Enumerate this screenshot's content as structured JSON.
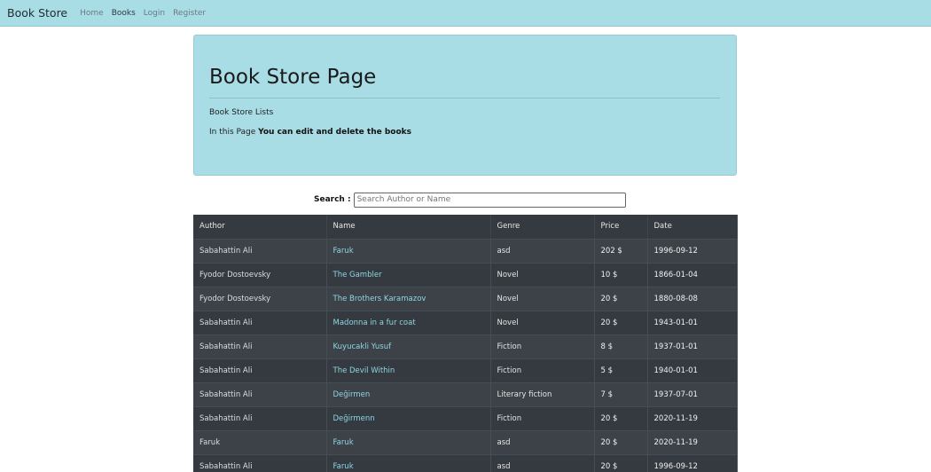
{
  "navbar": {
    "brand": "Book Store",
    "links": [
      {
        "label": "Home"
      },
      {
        "label": "Books"
      },
      {
        "label": "Login"
      },
      {
        "label": "Register"
      }
    ]
  },
  "jumbotron": {
    "title": "Book Store Page",
    "subtitle": "Book Store Lists",
    "description_prefix": "In this Page ",
    "description_bold": "You can edit and delete the books"
  },
  "search": {
    "label": "Search :",
    "placeholder": "Search Author or Name"
  },
  "table": {
    "headers": [
      "Author",
      "Name",
      "Genre",
      "Price",
      "Date"
    ],
    "rows": [
      {
        "author": "Sabahattin Ali",
        "name": "Faruk",
        "genre": "asd",
        "price": "202 $",
        "date": "1996-09-12"
      },
      {
        "author": "Fyodor Dostoevsky",
        "name": "The Gambler",
        "genre": "Novel",
        "price": "10 $",
        "date": "1866-01-04"
      },
      {
        "author": "Fyodor Dostoevsky",
        "name": "The Brothers Karamazov",
        "genre": "Novel",
        "price": "20 $",
        "date": "1880-08-08"
      },
      {
        "author": "Sabahattin Ali",
        "name": "Madonna in a fur coat",
        "genre": "Novel",
        "price": "20 $",
        "date": "1943-01-01"
      },
      {
        "author": "Sabahattin Ali",
        "name": "Kuyucakli Yusuf",
        "genre": "Fiction",
        "price": "8 $",
        "date": "1937-01-01"
      },
      {
        "author": "Sabahattin Ali",
        "name": "The Devil Within",
        "genre": "Fiction",
        "price": "5 $",
        "date": "1940-01-01"
      },
      {
        "author": "Sabahattin Ali",
        "name": "Değirmen",
        "genre": "Literary fiction",
        "price": "7 $",
        "date": "1937-07-01"
      },
      {
        "author": "Sabahattin Ali",
        "name": "Değirmenn",
        "genre": "Fiction",
        "price": "20 $",
        "date": "2020-11-19"
      },
      {
        "author": "Faruk",
        "name": "Faruk",
        "genre": "asd",
        "price": "20 $",
        "date": "2020-11-19"
      },
      {
        "author": "Sabahattin Ali",
        "name": "Faruk",
        "genre": "asd",
        "price": "20 $",
        "date": "1996-09-12"
      }
    ]
  },
  "colors": {
    "navbar_bg": "#a8dde6",
    "jumbotron_bg": "#a8dde6",
    "table_dark": "#343a40",
    "table_striped": "#3d4248",
    "link_accent": "#8fd6e2"
  }
}
